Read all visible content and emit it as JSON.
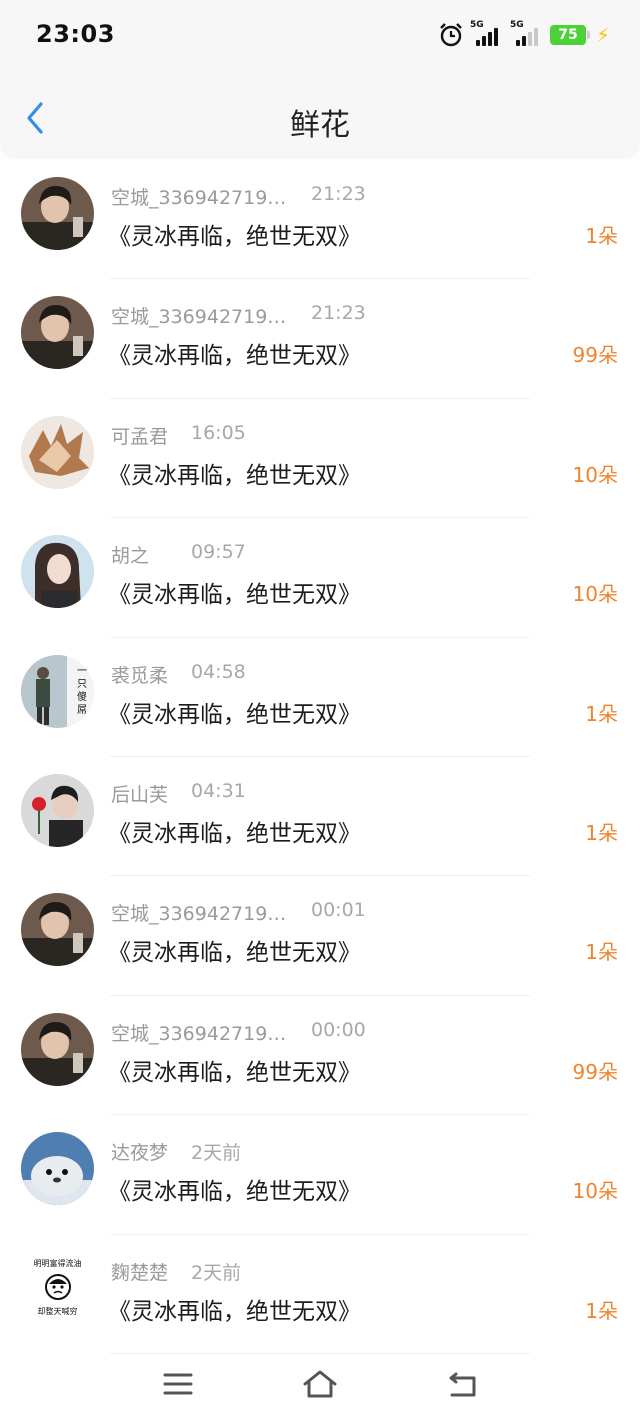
{
  "status_bar": {
    "time": "23:03",
    "network_1": "5G",
    "network_2": "5G",
    "battery_level": "75",
    "icons": [
      "alarm-icon",
      "signal-icon",
      "signal-icon",
      "battery-icon",
      "charging-icon"
    ]
  },
  "header": {
    "title": "鲜花",
    "back_icon": "chevron-left-icon",
    "accent_color": "#2f8fe8"
  },
  "list": {
    "count_color": "#f0842c",
    "items": [
      {
        "name": "空城_336942719…",
        "time": "21:23",
        "book": "《灵冰再临，绝世无双》",
        "count": "1朵"
      },
      {
        "name": "空城_336942719…",
        "time": "21:23",
        "book": "《灵冰再临，绝世无双》",
        "count": "99朵"
      },
      {
        "name": "可孟君",
        "time": "16:05",
        "book": "《灵冰再临，绝世无双》",
        "count": "10朵"
      },
      {
        "name": "胡之",
        "time": "09:57",
        "book": "《灵冰再临，绝世无双》",
        "count": "10朵"
      },
      {
        "name": "裘觅柔",
        "time": "04:58",
        "book": "《灵冰再临，绝世无双》",
        "count": "1朵"
      },
      {
        "name": "后山芙",
        "time": "04:31",
        "book": "《灵冰再临，绝世无双》",
        "count": "1朵"
      },
      {
        "name": "空城_336942719…",
        "time": "00:01",
        "book": "《灵冰再临，绝世无双》",
        "count": "1朵"
      },
      {
        "name": "空城_336942719…",
        "time": "00:00",
        "book": "《灵冰再临，绝世无双》",
        "count": "99朵"
      },
      {
        "name": "达夜梦",
        "time": "2天前",
        "book": "《灵冰再临，绝世无双》",
        "count": "10朵"
      },
      {
        "name": "麴楚楚",
        "time": "2天前",
        "book": "《灵冰再临，绝世无双》",
        "count": "1朵"
      }
    ],
    "avatar_5_text": [
      "一",
      "只",
      "傻",
      "屌"
    ],
    "avatar_10_text": [
      "明明富得流油",
      "却整天喊穷"
    ]
  },
  "nav_bar": {
    "icons": [
      "menu-icon",
      "home-icon",
      "back-icon"
    ]
  }
}
